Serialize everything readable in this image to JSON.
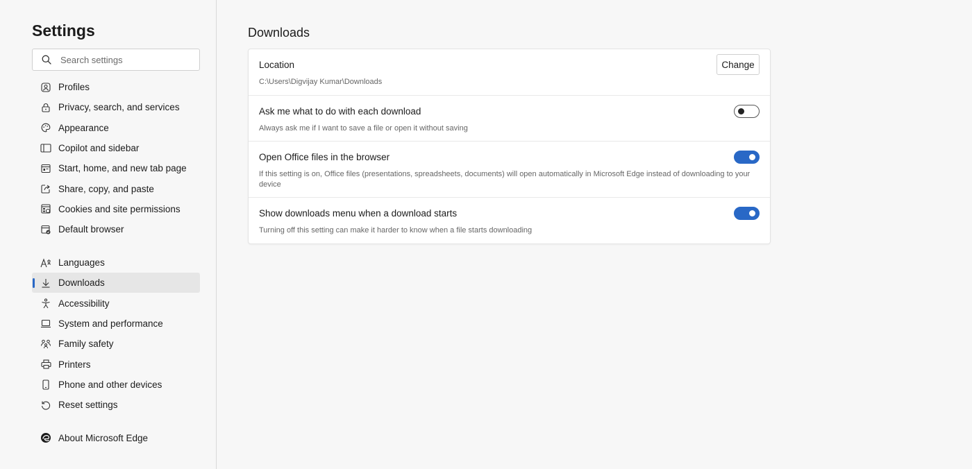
{
  "sidebar": {
    "title": "Settings",
    "search": {
      "placeholder": "Search settings",
      "value": ""
    },
    "group1": [
      {
        "label": "Profiles",
        "icon": "profile-icon"
      },
      {
        "label": "Privacy, search, and services",
        "icon": "lock-icon"
      },
      {
        "label": "Appearance",
        "icon": "palette-icon"
      },
      {
        "label": "Copilot and sidebar",
        "icon": "sidebar-panel-icon"
      },
      {
        "label": "Start, home, and new tab page",
        "icon": "home-tab-icon"
      },
      {
        "label": "Share, copy, and paste",
        "icon": "share-icon"
      },
      {
        "label": "Cookies and site permissions",
        "icon": "cookies-icon"
      },
      {
        "label": "Default browser",
        "icon": "default-browser-icon"
      }
    ],
    "group2": [
      {
        "label": "Languages",
        "icon": "languages-icon"
      },
      {
        "label": "Downloads",
        "icon": "download-icon",
        "active": true
      },
      {
        "label": "Accessibility",
        "icon": "accessibility-icon"
      },
      {
        "label": "System and performance",
        "icon": "laptop-icon"
      },
      {
        "label": "Family safety",
        "icon": "family-icon"
      },
      {
        "label": "Printers",
        "icon": "printer-icon"
      },
      {
        "label": "Phone and other devices",
        "icon": "phone-icon"
      },
      {
        "label": "Reset settings",
        "icon": "reset-icon"
      }
    ],
    "about": {
      "label": "About Microsoft Edge",
      "icon": "edge-logo-icon"
    }
  },
  "main": {
    "title": "Downloads",
    "location": {
      "title": "Location",
      "path": "C:\\Users\\Digvijay Kumar\\Downloads",
      "button": "Change"
    },
    "ask": {
      "title": "Ask me what to do with each download",
      "desc": "Always ask me if I want to save a file or open it without saving",
      "enabled": false
    },
    "office": {
      "title": "Open Office files in the browser",
      "desc": "If this setting is on, Office files (presentations, spreadsheets, documents) will open automatically in Microsoft Edge instead of downloading to your device",
      "enabled": true
    },
    "menu": {
      "title": "Show downloads menu when a download starts",
      "desc": "Turning off this setting can make it harder to know when a file starts downloading",
      "enabled": true
    }
  },
  "colors": {
    "accent": "#2968c6",
    "background": "#f7f7f7",
    "card": "#ffffff"
  }
}
